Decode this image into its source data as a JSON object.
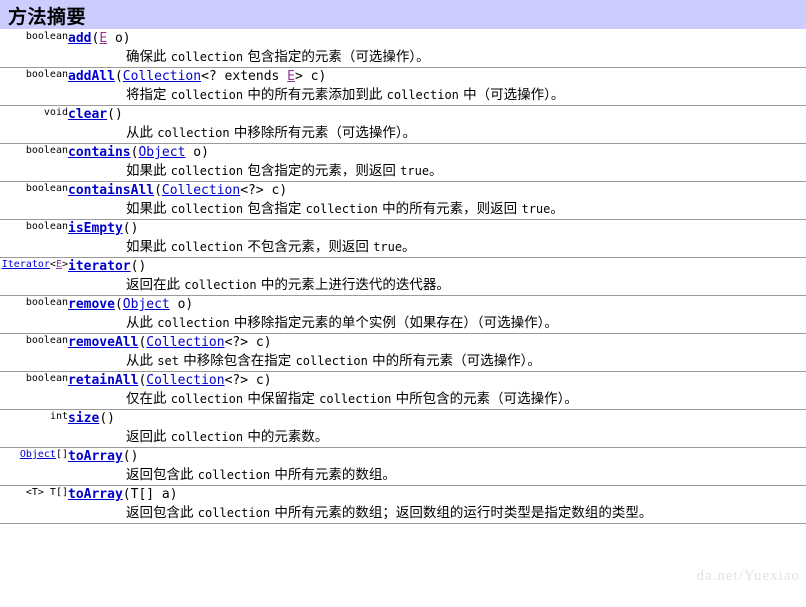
{
  "header": {
    "title": "方法摘要"
  },
  "watermark": "da.net/Yuexiao",
  "table": {
    "rows": [
      {
        "return_type_parts": [
          {
            "text": "boolean",
            "style": "plain"
          }
        ],
        "signature_parts": [
          {
            "text": "add",
            "style": "link-bold"
          },
          {
            "text": "(",
            "style": "plain"
          },
          {
            "text": "E",
            "style": "typevar"
          },
          {
            "text": " o)",
            "style": "plain"
          }
        ],
        "description": "确保此 collection 包含指定的元素（可选操作）。"
      },
      {
        "return_type_parts": [
          {
            "text": "boolean",
            "style": "plain"
          }
        ],
        "signature_parts": [
          {
            "text": "addAll",
            "style": "link-bold"
          },
          {
            "text": "(",
            "style": "plain"
          },
          {
            "text": "Collection",
            "style": "link"
          },
          {
            "text": "<? extends ",
            "style": "plain"
          },
          {
            "text": "E",
            "style": "typevar"
          },
          {
            "text": "> c)",
            "style": "plain"
          }
        ],
        "description": "将指定 collection 中的所有元素添加到此 collection 中（可选操作）。"
      },
      {
        "return_type_parts": [
          {
            "text": "void",
            "style": "plain"
          }
        ],
        "signature_parts": [
          {
            "text": "clear",
            "style": "link-bold"
          },
          {
            "text": "()",
            "style": "plain"
          }
        ],
        "description": "从此 collection 中移除所有元素（可选操作）。"
      },
      {
        "return_type_parts": [
          {
            "text": "boolean",
            "style": "plain"
          }
        ],
        "signature_parts": [
          {
            "text": "contains",
            "style": "link-bold"
          },
          {
            "text": "(",
            "style": "plain"
          },
          {
            "text": "Object",
            "style": "link"
          },
          {
            "text": " o)",
            "style": "plain"
          }
        ],
        "description": "如果此 collection 包含指定的元素，则返回 true。"
      },
      {
        "return_type_parts": [
          {
            "text": "boolean",
            "style": "plain"
          }
        ],
        "signature_parts": [
          {
            "text": "containsAll",
            "style": "link-bold"
          },
          {
            "text": "(",
            "style": "plain"
          },
          {
            "text": "Collection",
            "style": "link"
          },
          {
            "text": "<?> c)",
            "style": "plain"
          }
        ],
        "description": "如果此 collection 包含指定 collection 中的所有元素，则返回 true。"
      },
      {
        "return_type_parts": [
          {
            "text": "boolean",
            "style": "plain"
          }
        ],
        "signature_parts": [
          {
            "text": "isEmpty",
            "style": "link-bold"
          },
          {
            "text": "()",
            "style": "plain"
          }
        ],
        "description": "如果此 collection 不包含元素，则返回 true。"
      },
      {
        "return_type_parts": [
          {
            "text": "Iterator",
            "style": "link"
          },
          {
            "text": "<",
            "style": "plain"
          },
          {
            "text": "E",
            "style": "typevar"
          },
          {
            "text": ">",
            "style": "plain"
          }
        ],
        "signature_parts": [
          {
            "text": "iterator",
            "style": "link-bold"
          },
          {
            "text": "()",
            "style": "plain"
          }
        ],
        "description": "返回在此 collection 中的元素上进行迭代的迭代器。"
      },
      {
        "return_type_parts": [
          {
            "text": "boolean",
            "style": "plain"
          }
        ],
        "signature_parts": [
          {
            "text": "remove",
            "style": "link-bold"
          },
          {
            "text": "(",
            "style": "plain"
          },
          {
            "text": "Object",
            "style": "link"
          },
          {
            "text": " o)",
            "style": "plain"
          }
        ],
        "description": "从此 collection 中移除指定元素的单个实例（如果存在）（可选操作）。"
      },
      {
        "return_type_parts": [
          {
            "text": "boolean",
            "style": "plain"
          }
        ],
        "signature_parts": [
          {
            "text": "removeAll",
            "style": "link-bold"
          },
          {
            "text": "(",
            "style": "plain"
          },
          {
            "text": "Collection",
            "style": "link"
          },
          {
            "text": "<?> c)",
            "style": "plain"
          }
        ],
        "description": "从此 set 中移除包含在指定 collection 中的所有元素（可选操作）。"
      },
      {
        "return_type_parts": [
          {
            "text": "boolean",
            "style": "plain"
          }
        ],
        "signature_parts": [
          {
            "text": "retainAll",
            "style": "link-bold"
          },
          {
            "text": "(",
            "style": "plain"
          },
          {
            "text": "Collection",
            "style": "link"
          },
          {
            "text": "<?> c)",
            "style": "plain"
          }
        ],
        "description": "仅在此 collection 中保留指定 collection 中所包含的元素（可选操作）。"
      },
      {
        "return_type_parts": [
          {
            "text": "int",
            "style": "plain"
          }
        ],
        "signature_parts": [
          {
            "text": "size",
            "style": "link-bold"
          },
          {
            "text": "()",
            "style": "plain"
          }
        ],
        "description": "返回此 collection 中的元素数。"
      },
      {
        "return_type_parts": [
          {
            "text": "Object",
            "style": "link"
          },
          {
            "text": "[]",
            "style": "plain"
          }
        ],
        "signature_parts": [
          {
            "text": "toArray",
            "style": "link-bold"
          },
          {
            "text": "()",
            "style": "plain"
          }
        ],
        "description": "返回包含此 collection 中所有元素的数组。"
      },
      {
        "return_type_parts": [
          {
            "text": "<T> T[]",
            "style": "plain"
          }
        ],
        "signature_parts": [
          {
            "text": "toArray",
            "style": "link-bold"
          },
          {
            "text": "(T[] a)",
            "style": "plain"
          }
        ],
        "description": "返回包含此 collection 中所有元素的数组；返回数组的运行时类型是指定数组的类型。"
      }
    ]
  }
}
